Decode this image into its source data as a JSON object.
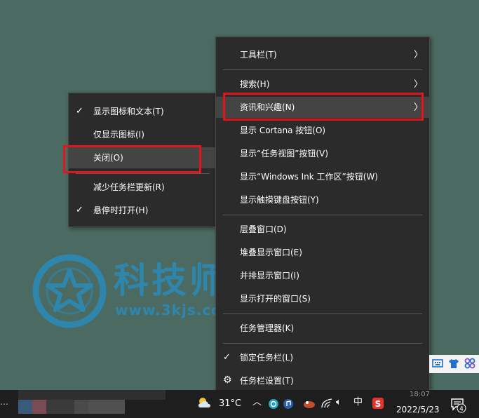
{
  "context_menu": {
    "items": [
      {
        "label": "工具栏(T)",
        "submenu": true
      },
      {
        "label": "搜索(H)",
        "submenu": true
      },
      {
        "label": "资讯和兴趣(N)",
        "submenu": true
      },
      {
        "label": "显示 Cortana 按钮(O)"
      },
      {
        "label": "显示“任务视图”按钮(V)"
      },
      {
        "label": "显示“Windows Ink 工作区”按钮(W)"
      },
      {
        "label": "显示触摸键盘按钮(Y)"
      },
      {
        "label": "层叠窗口(D)"
      },
      {
        "label": "堆叠显示窗口(E)"
      },
      {
        "label": "并排显示窗口(I)"
      },
      {
        "label": "显示打开的窗口(S)"
      },
      {
        "label": "任务管理器(K)"
      },
      {
        "label": "锁定任务栏(L)",
        "checked": true
      },
      {
        "label": "任务栏设置(T)",
        "icon": "gear-icon"
      }
    ]
  },
  "submenu": {
    "items": [
      {
        "label": "显示图标和文本(T)",
        "checked": true
      },
      {
        "label": "仅显示图标(I)"
      },
      {
        "label": "关闭(O)"
      },
      {
        "label": "减少任务栏更新(R)"
      },
      {
        "label": "悬停时打开(H)",
        "checked": true
      }
    ]
  },
  "watermark": {
    "title": "科技师",
    "url": "www.3kjs.com"
  },
  "taskbar": {
    "left_text": "…",
    "weather_temp": "31°C",
    "ime": "中",
    "clock_time": "18:07",
    "clock_date": "2022/5/23",
    "notification_count": "4"
  },
  "colors": {
    "desktop": "#4b6b62",
    "menu_bg": "#2b2b2b",
    "highlight": "#444444",
    "annotation_red": "#e0161c",
    "watermark_blue": "#2f86ad"
  }
}
